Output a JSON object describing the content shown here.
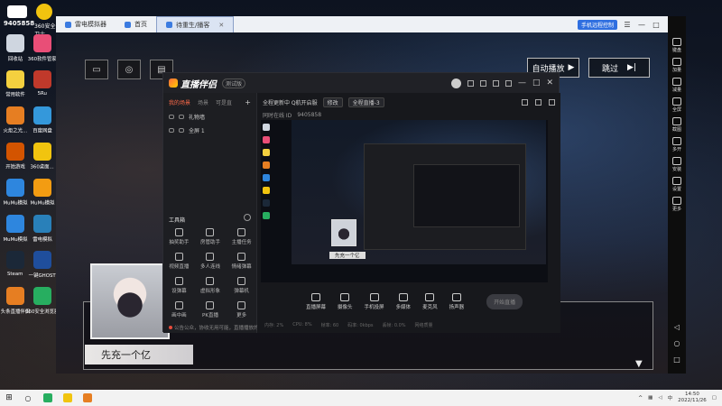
{
  "badge": {
    "number": "9405858",
    "security": "360安全卫士"
  },
  "desktop_icons": [
    {
      "label": "回收站",
      "color": "#cfd6e0"
    },
    {
      "label": "360软件管家",
      "color": "#e94e77"
    },
    {
      "label": "常用软件",
      "color": "#f4d03f"
    },
    {
      "label": "5Ru",
      "color": "#c0392b"
    },
    {
      "label": "火炬之光...",
      "color": "#e67e22"
    },
    {
      "label": "百度网盘",
      "color": "#3498db"
    },
    {
      "label": "开始游戏",
      "color": "#d35400"
    },
    {
      "label": "360桌面...",
      "color": "#f1c40f"
    },
    {
      "label": "MuMu模拟",
      "color": "#2e86de"
    },
    {
      "label": "MuMu模拟",
      "color": "#f39c12"
    },
    {
      "label": "MuMu模拟",
      "color": "#2e86de"
    },
    {
      "label": "雷电模拟",
      "color": "#2980b9"
    },
    {
      "label": "Steam",
      "color": "#1b2838"
    },
    {
      "label": "一键GHOST",
      "color": "#1f4e9c"
    },
    {
      "label": "头条直播伴侣",
      "color": "#e67e22"
    },
    {
      "label": "360安全浏览器",
      "color": "#27ae60"
    }
  ],
  "emulator": {
    "tabs": [
      {
        "label": "雷电模拟器",
        "active": false
      },
      {
        "label": "首页",
        "active": false
      },
      {
        "label": "待重生/播客",
        "active": true
      }
    ],
    "phone_pill": "手机远程控制",
    "window_controls": [
      "☰",
      "—",
      "□",
      "✕"
    ],
    "auto_play": "自动播放",
    "skip": "跳过",
    "speaker": "先充一个亿",
    "side_buttons": [
      "键盘",
      "加量",
      "减量",
      "全屏",
      "截图",
      "多开",
      "安装",
      "设置",
      "更多"
    ]
  },
  "stream_app": {
    "logo": "直播伴侣",
    "version": "测试版",
    "scene_tabs": [
      "我的场景",
      "场景",
      "可是直"
    ],
    "sources": [
      "礼物墙",
      "全屏 1"
    ],
    "tools_label": "工具箱",
    "tools": [
      "抽奖助手",
      "房管助手",
      "主播任务",
      "视频直播",
      "多人连线",
      "情绪弹幕",
      "设弹幕",
      "虚拟形象",
      "弹幕机",
      "画中画",
      "PK直播",
      "更多"
    ],
    "notice": "公告公众，协收无用可能，直播播放的，更上一层楼",
    "stream_title": "全程更新中 Q航开启服",
    "edit_label": "修改",
    "category": "全程直播-3",
    "room_prefix": "同时在线 ID",
    "room_id": "9405858",
    "controls": [
      "直播屏幕",
      "摄像头",
      "手机投屏",
      "多媒体",
      "麦克风",
      "扬声器"
    ],
    "start_live": "开始直播",
    "status": [
      "内存: 2%",
      "CPU: 8%",
      "帧率: 60",
      "码率: 0kbps",
      "丢帧: 0.0%",
      "网络质量"
    ]
  },
  "taskbar": {
    "time": "14:50",
    "date": "2022/11/26",
    "ime": "中"
  }
}
